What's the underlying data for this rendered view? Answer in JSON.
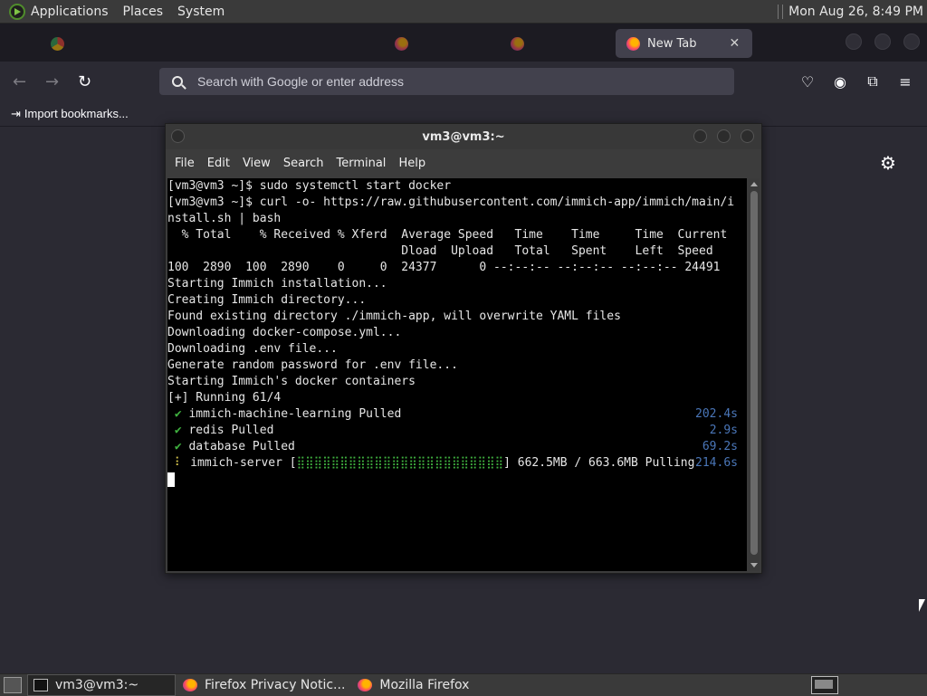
{
  "top_panel": {
    "menus": [
      "Applications",
      "Places",
      "System"
    ],
    "clock": "Mon Aug 26,  8:49 PM"
  },
  "firefox": {
    "tabs": [
      {
        "label": "",
        "icon": "chrome-icon"
      },
      {
        "label": "",
        "icon": "firefox-icon"
      },
      {
        "label": "",
        "icon": "firefox-icon"
      },
      {
        "label": "",
        "icon": "firefox-icon"
      },
      {
        "label": "New Tab",
        "icon": "firefox-icon",
        "active": true
      }
    ],
    "url_placeholder": "Search with Google or enter address",
    "bookmark_import": "Import bookmarks..."
  },
  "terminal": {
    "title": "vm3@vm3:~",
    "menu": [
      "File",
      "Edit",
      "View",
      "Search",
      "Terminal",
      "Help"
    ],
    "lines": [
      "[vm3@vm3 ~]$ sudo systemctl start docker",
      "[vm3@vm3 ~]$ curl -o- https://raw.githubusercontent.com/immich-app/immich/main/i",
      "nstall.sh | bash",
      "  % Total    % Received % Xferd  Average Speed   Time    Time     Time  Current",
      "                                 Dload  Upload   Total   Spent    Left  Speed",
      "100  2890  100  2890    0     0  24377      0 --:--:-- --:--:-- --:--:-- 24491",
      "Starting Immich installation...",
      "Creating Immich directory...",
      "Found existing directory ./immich-app, will overwrite YAML files",
      "Downloading docker-compose.yml...",
      "Downloading .env file...",
      "Generate random password for .env file...",
      "Starting Immich's docker containers",
      "[+] Running 61/4"
    ],
    "status_rows": [
      {
        "mark": "✔",
        "name": "immich-machine-learning Pulled",
        "time": "202.4s"
      },
      {
        "mark": "✔",
        "name": "redis Pulled",
        "time": "2.9s"
      },
      {
        "mark": "✔",
        "name": "database Pulled",
        "time": "69.2s"
      }
    ],
    "progress_row": {
      "mark": "⠇",
      "name": "immich-server [",
      "bar": "⣿⣿⣿⣿⣿⣿⣿⣿⣿⣿⣿⣿⣿⣿⣿⣿⣿⣿⣿⣿⣿⣿⣿⣿",
      "suffix": "] 662.5MB / 663.6MB Pulling",
      "time": "214.6s"
    }
  },
  "taskbar": {
    "items": [
      "vm3@vm3:~",
      "Firefox Privacy Notic...",
      "Mozilla Firefox"
    ]
  }
}
